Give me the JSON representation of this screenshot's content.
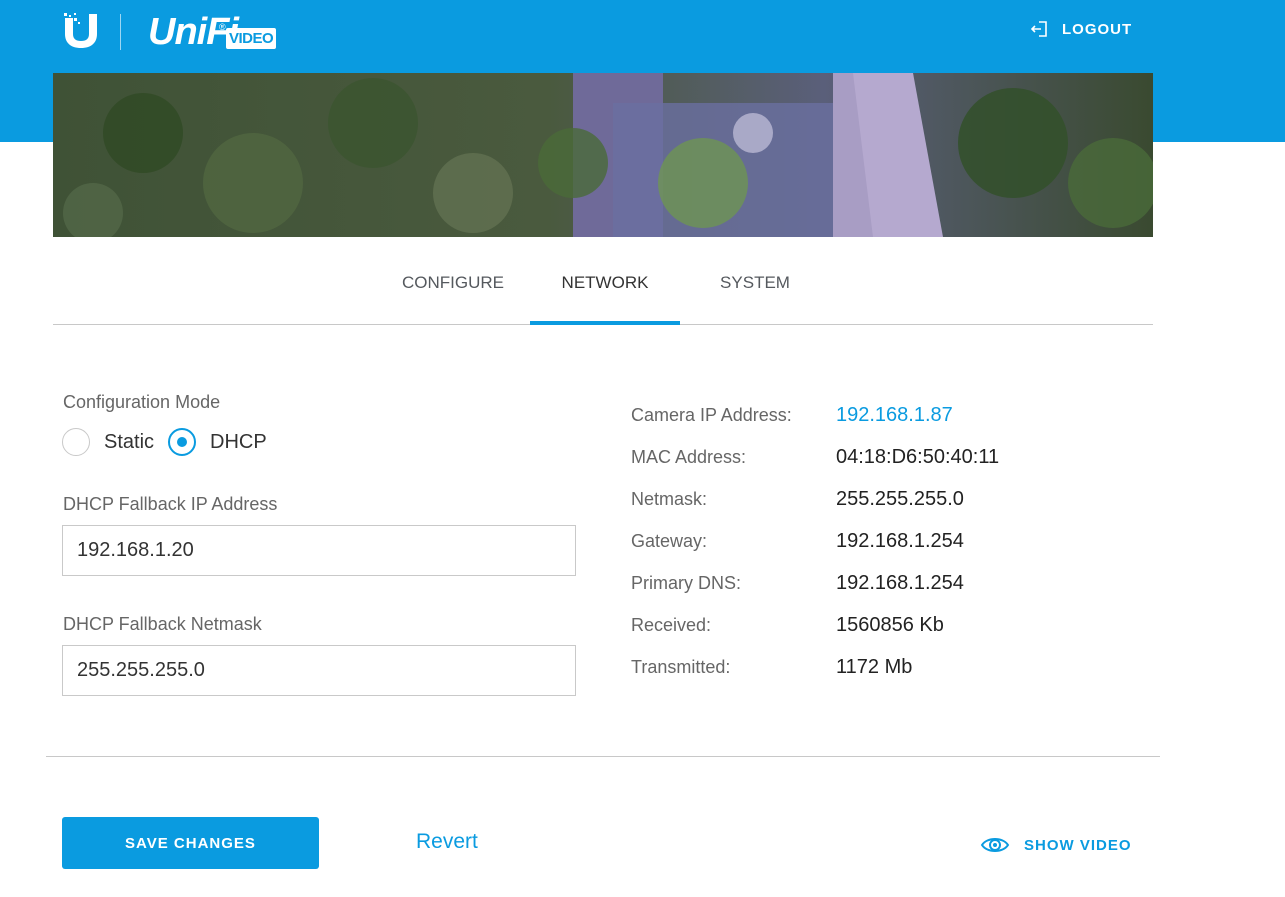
{
  "header": {
    "logo_text": "UniFi",
    "logo_badge": "VIDEO",
    "logout_label": "LOGOUT",
    "logout_icon": "logout-icon",
    "color": "#0a9be0"
  },
  "tabs": [
    {
      "label": "CONFIGURE",
      "active": false
    },
    {
      "label": "NETWORK",
      "active": true
    },
    {
      "label": "SYSTEM",
      "active": false
    }
  ],
  "config": {
    "mode_label": "Configuration Mode",
    "options": [
      {
        "label": "Static",
        "checked": false
      },
      {
        "label": "DHCP",
        "checked": true
      }
    ],
    "fallback_ip_label": "DHCP Fallback IP Address",
    "fallback_ip_value": "192.168.1.20",
    "fallback_netmask_label": "DHCP Fallback Netmask",
    "fallback_netmask_value": "255.255.255.0"
  },
  "info": [
    {
      "key": "Camera IP Address:",
      "value": "192.168.1.87",
      "link": true
    },
    {
      "key": "MAC Address:",
      "value": "04:18:D6:50:40:11"
    },
    {
      "key": "Netmask:",
      "value": "255.255.255.0"
    },
    {
      "key": "Gateway:",
      "value": "192.168.1.254"
    },
    {
      "key": "Primary DNS:",
      "value": "192.168.1.254"
    },
    {
      "key": "Received:",
      "value": "1560856 Kb"
    },
    {
      "key": "Transmitted:",
      "value": "1172 Mb"
    }
  ],
  "footer": {
    "save_label": "SAVE CHANGES",
    "revert_label": "Revert",
    "show_video_label": "SHOW VIDEO",
    "show_video_icon": "eye-icon"
  }
}
